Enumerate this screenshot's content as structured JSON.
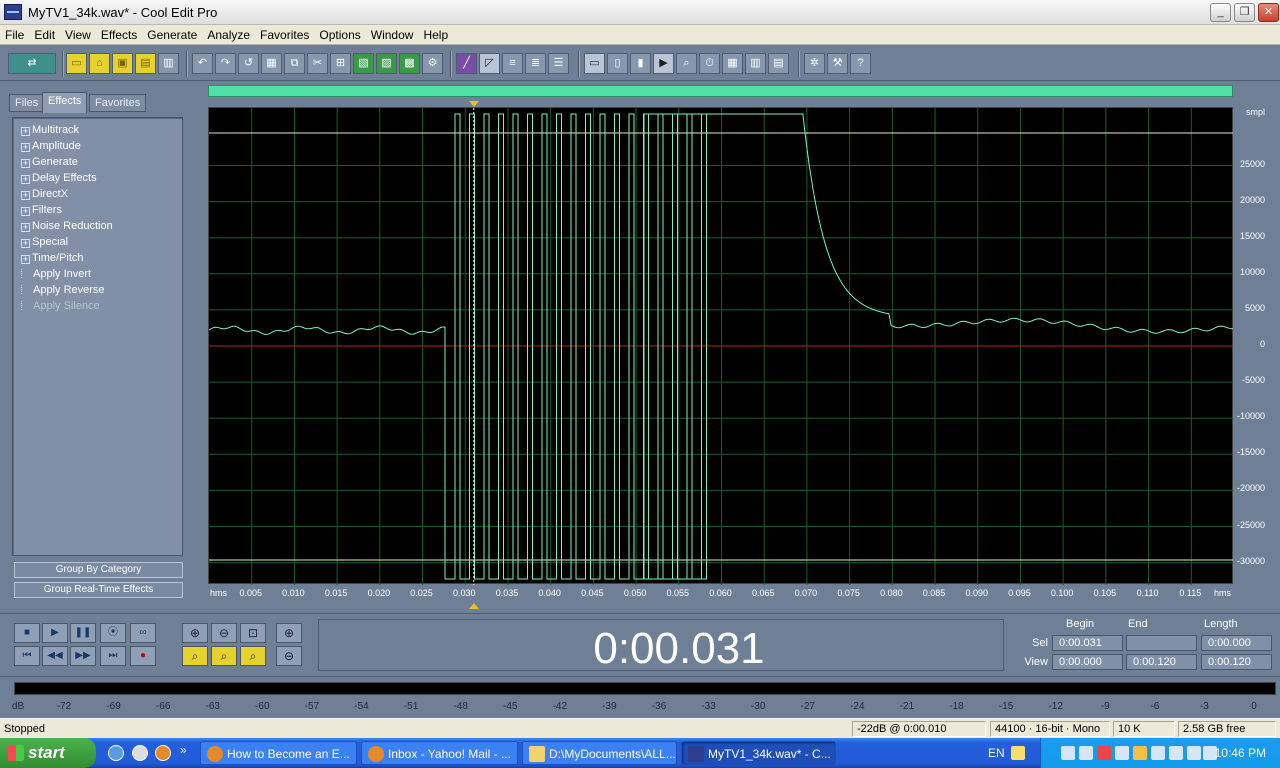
{
  "window": {
    "title": "MyTV1_34k.wav* - Cool Edit Pro"
  },
  "menu": [
    "File",
    "Edit",
    "View",
    "Effects",
    "Generate",
    "Analyze",
    "Favorites",
    "Options",
    "Window",
    "Help"
  ],
  "left_panel": {
    "tabs": [
      "Files",
      "Effects",
      "Favorites"
    ],
    "active_tab": "Effects",
    "tree": [
      {
        "label": "Multitrack",
        "type": "folder"
      },
      {
        "label": "Amplitude",
        "type": "folder"
      },
      {
        "label": "Generate",
        "type": "folder"
      },
      {
        "label": "Delay Effects",
        "type": "folder"
      },
      {
        "label": "DirectX",
        "type": "folder"
      },
      {
        "label": "Filters",
        "type": "folder"
      },
      {
        "label": "Noise Reduction",
        "type": "folder"
      },
      {
        "label": "Special",
        "type": "folder"
      },
      {
        "label": "Time/Pitch",
        "type": "folder"
      },
      {
        "label": "Apply Invert",
        "type": "leaf"
      },
      {
        "label": "Apply Reverse",
        "type": "leaf"
      },
      {
        "label": "Apply Silence",
        "type": "leaf-disabled"
      }
    ],
    "buttons": {
      "group_by_category": "Group By Category",
      "group_realtime": "Group Real-Time Effects"
    }
  },
  "waveform": {
    "y_unit": "smpl",
    "y_ticks": [
      "25000",
      "20000",
      "15000",
      "10000",
      "5000",
      "0",
      "-5000",
      "-10000",
      "-15000",
      "-20000",
      "-25000",
      "-30000"
    ],
    "x_unit_left": "hms",
    "x_unit_right": "hms",
    "x_ticks": [
      "0.005",
      "0.010",
      "0.015",
      "0.020",
      "0.025",
      "0.030",
      "0.035",
      "0.040",
      "0.045",
      "0.050",
      "0.055",
      "0.060",
      "0.065",
      "0.070",
      "0.075",
      "0.080",
      "0.085",
      "0.090",
      "0.095",
      "0.100",
      "0.105",
      "0.110",
      "0.115"
    ],
    "colors": {
      "wave": "#7cf0c0",
      "background": "#000000",
      "center_line": "#b02020",
      "grid": "#1c5c2c",
      "clip_line": "#e8e8c0"
    }
  },
  "transport": {
    "time_display": "0:00.031",
    "sel_view": {
      "headers": {
        "begin": "Begin",
        "end": "End",
        "length": "Length"
      },
      "sel": {
        "label": "Sel",
        "begin": "0:00.031",
        "end": "",
        "length": "0:00.000"
      },
      "view": {
        "label": "View",
        "begin": "0:00.000",
        "end": "0:00.120",
        "length": "0:00.120"
      }
    }
  },
  "level_meter": {
    "unit": "dB",
    "ticks": [
      "-72",
      "-69",
      "-66",
      "-63",
      "-60",
      "-57",
      "-54",
      "-51",
      "-48",
      "-45",
      "-42",
      "-39",
      "-36",
      "-33",
      "-30",
      "-27",
      "-24",
      "-21",
      "-18",
      "-15",
      "-12",
      "-9",
      "-6",
      "-3",
      "0"
    ]
  },
  "status": {
    "state": "Stopped",
    "cursor": "-22dB @  0:00.010",
    "format": "44100 · 16-bit · Mono",
    "size": "10 K",
    "free": "2.58 GB free"
  },
  "taskbar": {
    "start": "start",
    "tasks": [
      {
        "label": "How to Become an E..."
      },
      {
        "label": "Inbox - Yahoo! Mail - ..."
      },
      {
        "label": "D:\\MyDocuments\\ALL..."
      },
      {
        "label": "MyTV1_34k.wav* - C..."
      }
    ],
    "lang": "EN",
    "clock": "10:46 PM"
  }
}
